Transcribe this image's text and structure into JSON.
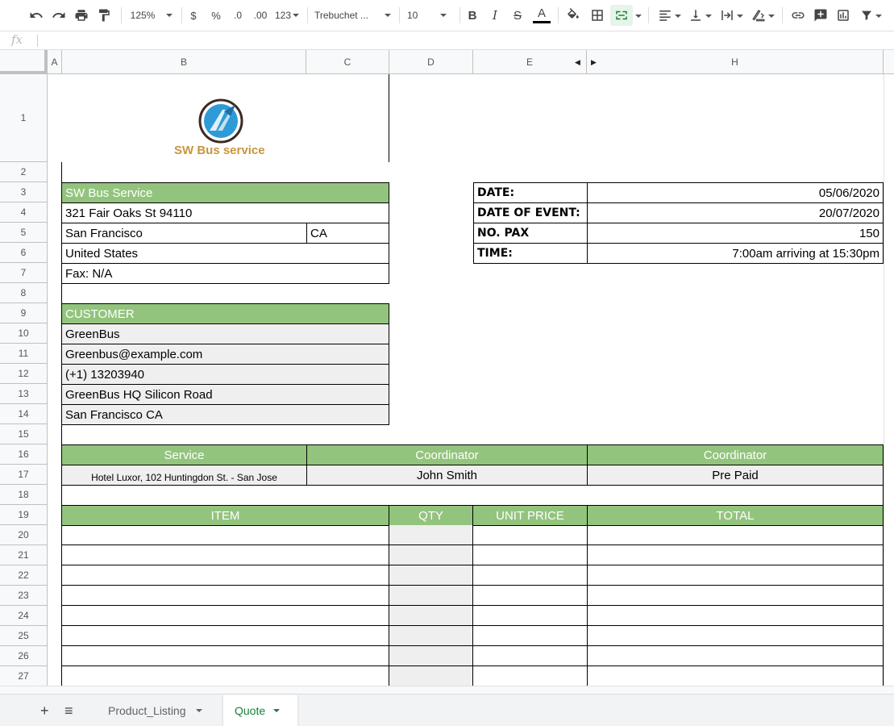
{
  "toolbar": {
    "zoom": "125%",
    "currency": "$",
    "percent": "%",
    "dec_decrease": ".0",
    "dec_increase": ".00",
    "more_formats": "123",
    "font": "Trebuchet ...",
    "font_size": "10"
  },
  "formula": {
    "fx": "fx"
  },
  "columns": [
    "A",
    "B",
    "C",
    "D",
    "E",
    "H"
  ],
  "rows": [
    "1",
    "2",
    "3",
    "4",
    "5",
    "6",
    "7",
    "8",
    "9",
    "10",
    "11",
    "12",
    "13",
    "14",
    "15",
    "16",
    "17",
    "18",
    "19",
    "20",
    "21",
    "22",
    "23",
    "24",
    "25",
    "26",
    "27"
  ],
  "logo": {
    "brand": "SW Bus service"
  },
  "company": {
    "name": "SW Bus Service",
    "address": "321 Fair Oaks St 94110",
    "city": "San Francisco",
    "state": "CA",
    "country": "United States",
    "fax": "Fax: N/A"
  },
  "details": {
    "date_label": "DATE:",
    "date_value": "05/06/2020",
    "event_label": "DATE OF EVENT:",
    "event_value": "20/07/2020",
    "pax_label": "NO. PAX",
    "pax_value": "150",
    "time_label": "TIME:",
    "time_value": "7:00am arriving at 15:30pm"
  },
  "customer": {
    "header": "CUSTOMER",
    "name": "GreenBus",
    "email": "Greenbus@example.com",
    "phone": "(+1) 13203940",
    "address": "GreenBus HQ Silicon Road",
    "city": "San Francisco CA"
  },
  "service": {
    "h1": "Service",
    "h2": "Coordinator",
    "h3": "Coordinator",
    "v1": "Hotel Luxor, 102 Huntingdon St. - San Jose",
    "v2": "John Smith",
    "v3": "Pre Paid"
  },
  "items": {
    "item": "ITEM",
    "qty": "QTY",
    "unit_price": "UNIT PRICE",
    "total": "TOTAL"
  },
  "sheets": {
    "tab1": "Product_Listing",
    "tab2": "Quote"
  },
  "colors": {
    "accent_green": "#93c47d",
    "active_tab": "#188038"
  }
}
